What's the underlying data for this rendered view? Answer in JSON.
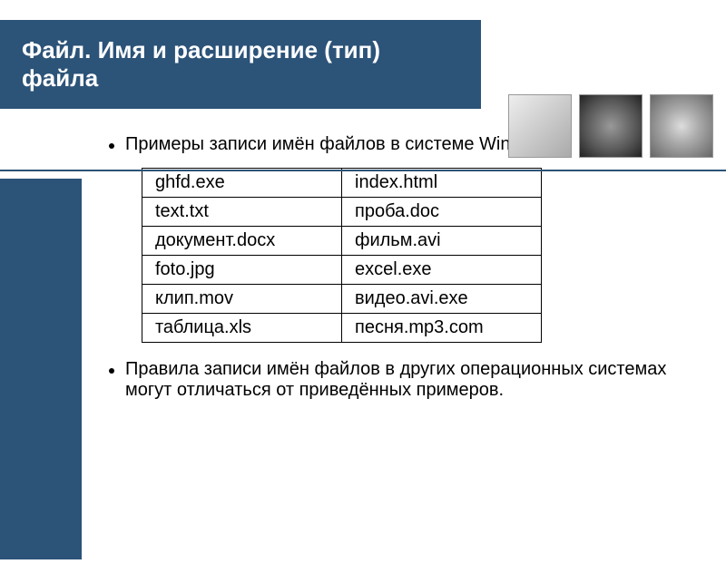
{
  "header": {
    "title": "Файл. Имя и расширение (тип) файла"
  },
  "content": {
    "intro": "Примеры записи имён файлов в системе Windows:",
    "outro": "Правила записи имён файлов в других операционных системах могут отличаться от приведённых примеров."
  },
  "table": {
    "rows": [
      {
        "c1": "ghfd.exe",
        "c2": "index.html"
      },
      {
        "c1": "text.txt",
        "c2": "проба.doc"
      },
      {
        "c1": "документ.docx",
        "c2": "фильм.avi"
      },
      {
        "c1": "foto.jpg",
        "c2": "excel.exe"
      },
      {
        "c1": "клип.mov",
        "c2": "видео.avi.exe"
      },
      {
        "c1": "таблица.xls",
        "c2": "песня.mp3.com"
      }
    ]
  }
}
